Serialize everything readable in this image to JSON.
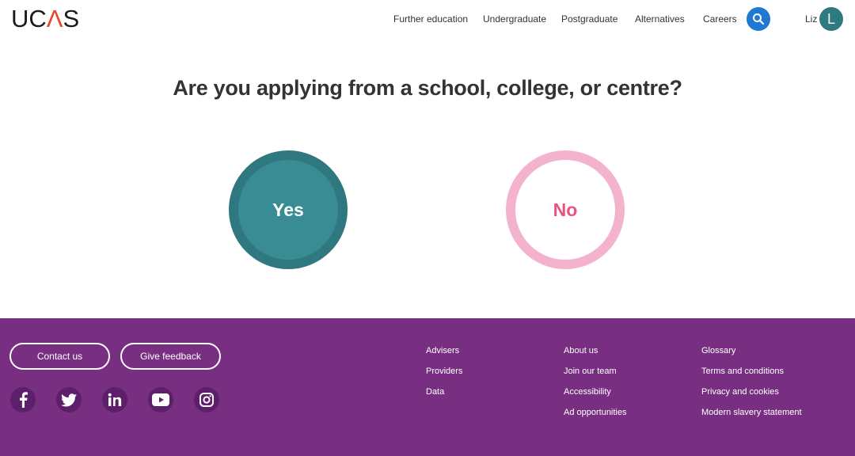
{
  "header": {
    "logo": {
      "pre": "UC",
      "accent": "Λ",
      "post": "S"
    },
    "nav": [
      "Further education",
      "Undergraduate",
      "Postgraduate",
      "Alternatives",
      "Careers"
    ],
    "search_icon": "search-icon",
    "user": {
      "name": "Liz",
      "initial": "L"
    }
  },
  "main": {
    "question": "Are you applying from a school, college, or centre?",
    "options": {
      "yes": "Yes",
      "no": "No"
    }
  },
  "footer": {
    "buttons": {
      "contact": "Contact us",
      "feedback": "Give feedback"
    },
    "social": [
      "facebook-icon",
      "twitter-icon",
      "linkedin-icon",
      "youtube-icon",
      "instagram-icon"
    ],
    "columns": [
      [
        "Advisers",
        "Providers",
        "Data"
      ],
      [
        "About us",
        "Join our team",
        "Accessibility",
        "Ad opportunities"
      ],
      [
        "Glossary",
        "Terms and conditions",
        "Privacy and cookies",
        "Modern slavery statement"
      ]
    ]
  },
  "colors": {
    "brand_red": "#e8452d",
    "search_blue": "#1f78d1",
    "teal": "#3a8c94",
    "teal_dark": "#2f7880",
    "pink_border": "#f4b3cc",
    "pink_text": "#e8547e",
    "footer_purple": "#782f82"
  }
}
